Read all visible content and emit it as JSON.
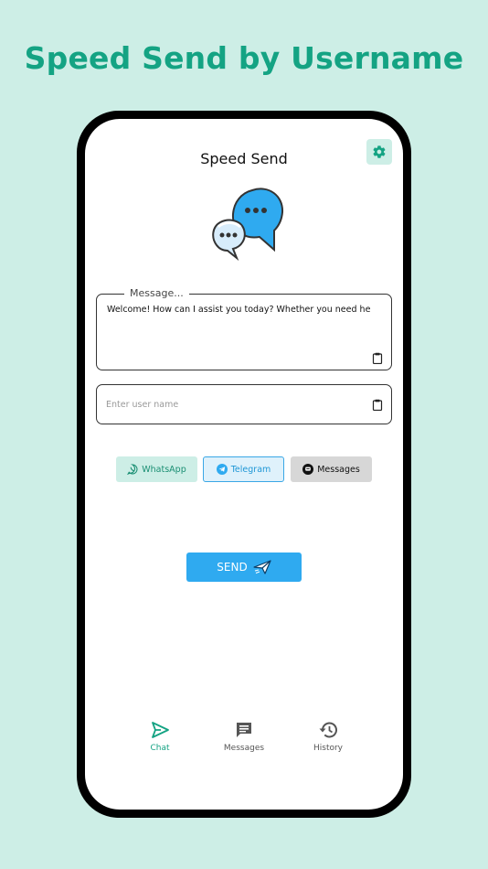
{
  "headline": "Speed Send by Username",
  "app": {
    "title": "Speed Send",
    "message_legend": "Message...",
    "message_text": "Welcome! How can I assist you today? Whether you need help.......",
    "username_placeholder": "Enter user name",
    "channels": [
      {
        "label": "WhatsApp",
        "icon": "whatsapp-icon"
      },
      {
        "label": "Telegram",
        "icon": "telegram-icon",
        "selected": true
      },
      {
        "label": "Messages",
        "icon": "messages-icon"
      }
    ],
    "send_label": "SEND",
    "nav": [
      {
        "label": "Chat",
        "icon": "send-icon",
        "active": true
      },
      {
        "label": "Messages",
        "icon": "message-icon"
      },
      {
        "label": "History",
        "icon": "history-icon"
      }
    ]
  },
  "colors": {
    "background": "#cdeee6",
    "brand_green": "#14a383",
    "send_blue": "#2faaf0",
    "telegram_blue": "#1f97d6"
  }
}
